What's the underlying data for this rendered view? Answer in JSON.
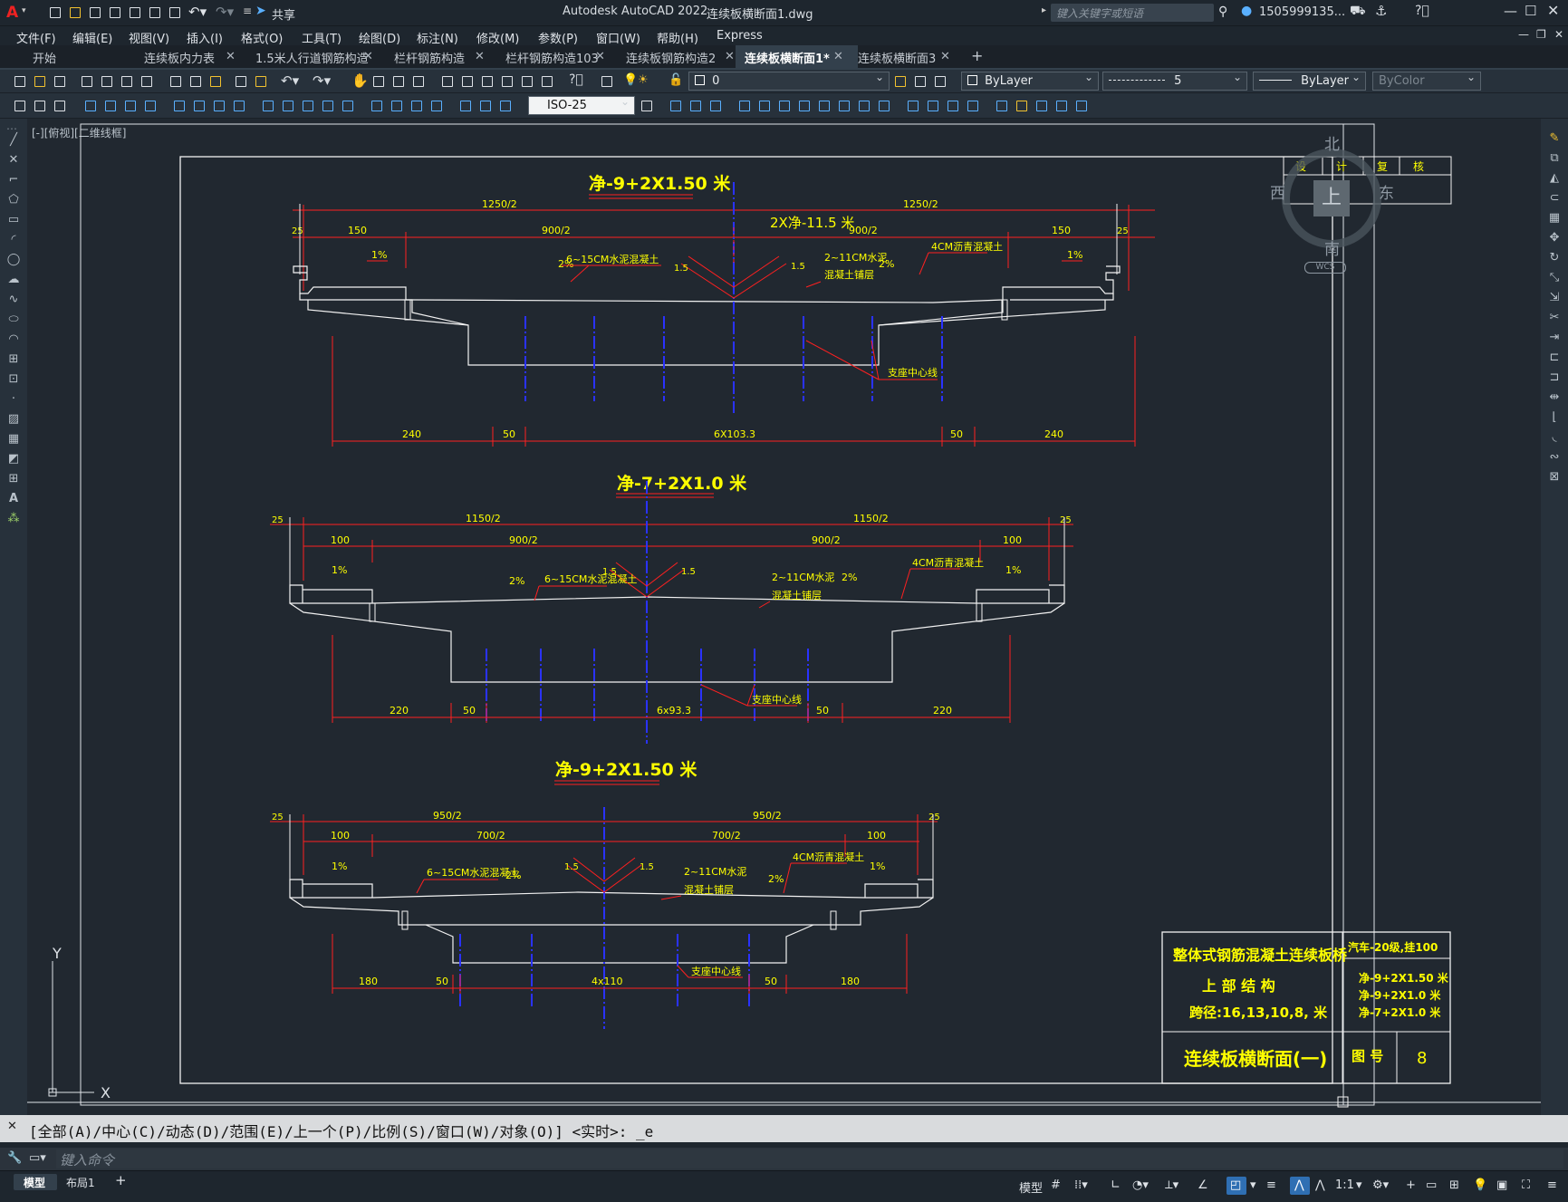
{
  "titlebar": {
    "app_title": "Autodesk AutoCAD 2022",
    "file_name": "连续板横断面1.dwg",
    "share_label": "共享",
    "search_placeholder": "键入关键字或短语",
    "user_name": "1505999135..."
  },
  "menu": [
    "文件(F)",
    "编辑(E)",
    "视图(V)",
    "插入(I)",
    "格式(O)",
    "工具(T)",
    "绘图(D)",
    "标注(N)",
    "修改(M)",
    "参数(P)",
    "窗口(W)",
    "帮助(H)",
    "Express"
  ],
  "tabs": [
    {
      "label": "开始",
      "active": false
    },
    {
      "label": "连续板内力表",
      "active": false
    },
    {
      "label": "1.5米人行道钢筋构造",
      "active": false
    },
    {
      "label": "栏杆钢筋构造",
      "active": false
    },
    {
      "label": "栏杆钢筋构造103",
      "active": false
    },
    {
      "label": "连续板钢筋构造2",
      "active": false
    },
    {
      "label": "连续板横断面1*",
      "active": true
    },
    {
      "label": "连续板横断面3",
      "active": false
    }
  ],
  "toolbar": {
    "layer_value": "0",
    "color_value": "ByLayer",
    "linetype_value": "5",
    "lineweight_value": "ByLayer",
    "plotstyle_value": "ByColor",
    "dimstyle_value": "ISO-25"
  },
  "viewport_label": "[-][俯视][二维线框]",
  "viewcube": {
    "north": "北",
    "south": "南",
    "east": "东",
    "west": "西",
    "top": "上",
    "wcs": "WCS"
  },
  "ucs": {
    "x": "X",
    "y": "Y"
  },
  "drawing": {
    "section1": {
      "title": "净-9+2X1.50 米",
      "half_left": "1250/2",
      "half_right": "1250/2",
      "center_note": "2X净-11.5 米",
      "edge": "25",
      "walk": "150",
      "road_left": "900/2",
      "road_right": "900/2",
      "slope_walk": "1%",
      "slope_road": "2%",
      "slope_small": "1.5",
      "layer1": "6~15CM水泥混凝土",
      "layer2a": "2~11CM水泥",
      "layer2b": "混凝土铺层",
      "layer3": "4CM沥青混凝土",
      "bearing": "支座中心线",
      "bot_side": "240",
      "bot_gap": "50",
      "bot_mid": "6X103.3"
    },
    "section2": {
      "title": "净-7+2X1.0 米",
      "half_left": "1150/2",
      "half_right": "1150/2",
      "edge": "25",
      "walk": "100",
      "road_left": "900/2",
      "road_right": "900/2",
      "slope_walk": "1%",
      "slope_road": "2%",
      "slope_small": "1.5",
      "layer1": "6~15CM水泥混凝土",
      "layer2a": "2~11CM水泥",
      "layer2b": "混凝土铺层",
      "layer3": "4CM沥青混凝土",
      "bearing": "支座中心线",
      "bot_side": "220",
      "bot_gap": "50",
      "bot_mid": "6x93.3"
    },
    "section3": {
      "title": "净-9+2X1.50 米",
      "half_left": "950/2",
      "half_right": "950/2",
      "edge": "25",
      "walk": "100",
      "road_left": "700/2",
      "road_right": "700/2",
      "slope_walk": "1%",
      "slope_road": "2%",
      "slope_small": "1.5",
      "layer1": "6~15CM水泥混凝土",
      "layer2a": "2~11CM水泥",
      "layer2b": "混凝土铺层",
      "layer3": "4CM沥青混凝土",
      "bearing": "支座中心线",
      "bot_side": "180",
      "bot_gap": "50",
      "bot_mid": "4x110"
    },
    "title_block": {
      "project": "整体式钢筋混凝土连续板桥",
      "part": "上 部 结 构",
      "span": "跨径:16,13,10,8,    米",
      "load": "汽车-20级,挂100",
      "w1": "净-9+2X1.50 米",
      "w2": "净-9+2X1.0 米",
      "w3": "净-7+2X1.0 米",
      "drawing_name": "连续板横断面(一)",
      "no_label": "图 号",
      "no_value": "8"
    },
    "signature_headers": [
      "设",
      "计",
      "复",
      "核"
    ]
  },
  "command": {
    "history": "[全部(A)/中心(C)/动态(D)/范围(E)/上一个(P)/比例(S)/窗口(W)/对象(O)] <实时>: _e",
    "placeholder": "键入命令"
  },
  "status": {
    "model_tab": "模型",
    "layout_tab": "布局1",
    "model_button": "模型",
    "scale": "1:1"
  }
}
